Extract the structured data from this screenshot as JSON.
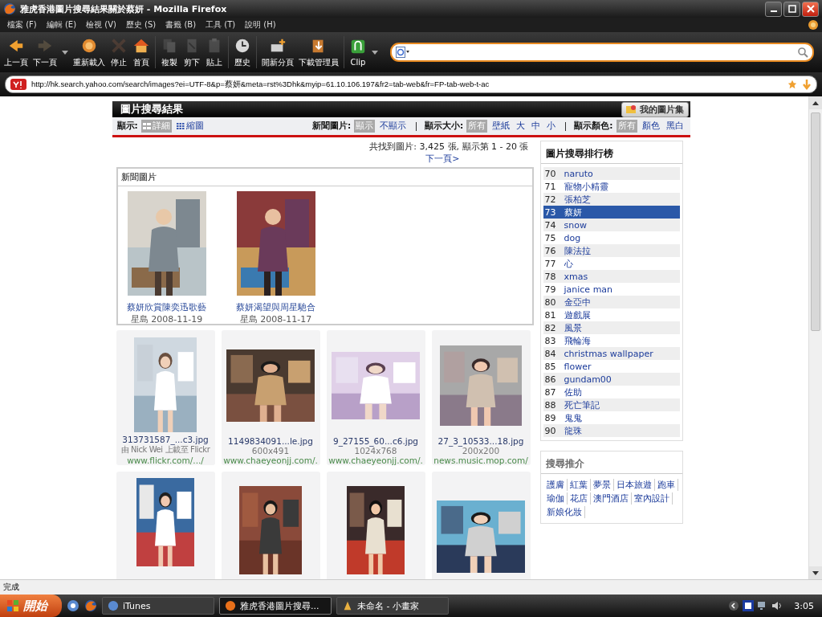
{
  "window": {
    "title": "雅虎香港圖片搜尋結果關於蔡妍 - Mozilla Firefox"
  },
  "menu": [
    "檔案 (F)",
    "編輯 (E)",
    "檢視 (V)",
    "歷史 (S)",
    "書籤 (B)",
    "工具 (T)",
    "說明 (H)"
  ],
  "toolbar": [
    {
      "kind": "back",
      "label": "上一頁",
      "disabled": false
    },
    {
      "kind": "forward",
      "label": "下一頁",
      "disabled": true
    },
    {
      "kind": "reload",
      "label": "重新載入",
      "disabled": false
    },
    {
      "kind": "stop",
      "label": "停止",
      "disabled": true
    },
    {
      "kind": "home",
      "label": "首頁",
      "disabled": false
    },
    {
      "kind": "copy",
      "label": "複製",
      "disabled": true
    },
    {
      "kind": "cut",
      "label": "剪下",
      "disabled": true
    },
    {
      "kind": "paste",
      "label": "貼上",
      "disabled": true
    },
    {
      "kind": "history",
      "label": "歷史",
      "disabled": false
    },
    {
      "kind": "newtab",
      "label": "開新分頁",
      "disabled": false
    },
    {
      "kind": "download",
      "label": "下載管理員",
      "disabled": false
    },
    {
      "kind": "clip",
      "label": "Clip",
      "disabled": false
    }
  ],
  "address": {
    "url": "http://hk.search.yahoo.com/search/images?ei=UTF-8&p=蔡妍&meta=rst%3Dhk&myip=61.10.106.197&fr2=tab-web&fr=FP-tab-web-t-ac"
  },
  "page": {
    "header": "圖片搜尋結果",
    "my_pictures": "我的圖片集",
    "filters": [
      {
        "label": "顯示:",
        "options": [
          {
            "text": "詳細",
            "selected": true
          },
          {
            "text": "縮圖",
            "selected": false
          }
        ]
      },
      {
        "label": "新聞圖片:",
        "options": [
          {
            "text": "顯示",
            "selected": true
          },
          {
            "text": "不顯示",
            "selected": false
          }
        ]
      },
      {
        "label": "顯示大小:",
        "options": [
          {
            "text": "所有",
            "selected": true
          },
          {
            "text": "壁紙",
            "selected": false
          },
          {
            "text": "大",
            "selected": false
          },
          {
            "text": "中",
            "selected": false
          },
          {
            "text": "小",
            "selected": false
          }
        ]
      },
      {
        "label": "顯示顏色:",
        "options": [
          {
            "text": "所有",
            "selected": true
          },
          {
            "text": "顏色",
            "selected": false
          },
          {
            "text": "黑白",
            "selected": false
          }
        ]
      }
    ],
    "summary": "共找到圖片: 3,425 張, 顯示第 1 - 20 張",
    "next_page": "下一頁>",
    "news": {
      "title": "新聞圖片",
      "items": [
        {
          "caption": "蔡妍欣賞陳奕迅歌藝",
          "source": "星島",
          "date": "2008-11-19"
        },
        {
          "caption": "蔡妍渴望與周星馳合",
          "source": "星島",
          "date": "2008-11-17"
        }
      ]
    },
    "results": [
      {
        "kind": "result",
        "file": "313731587_...c3.jpg",
        "info": "由 Nick Wei 上載至 Flickr",
        "site": "www.flickr.com/.../"
      },
      {
        "kind": "result",
        "file": "1149834091...le.jpg",
        "info": "600x491",
        "site": "www.chaeyeonjj.com/."
      },
      {
        "kind": "result",
        "file": "9_27155_60...c6.jpg",
        "info": "1024x768",
        "site": "www.chaeyeonjj.com/."
      },
      {
        "kind": "result",
        "file": "27_3_10533...18.jpg",
        "info": "200x200",
        "site": "news.music.mop.com/"
      },
      {
        "kind": "picture"
      },
      {
        "kind": "picture"
      },
      {
        "kind": "picture"
      },
      {
        "kind": "picture"
      }
    ],
    "ranking": {
      "title": "圖片搜尋排行榜",
      "items": [
        {
          "rank": "70",
          "term": "naruto",
          "selected": false
        },
        {
          "rank": "71",
          "term": "寵物小精靈",
          "selected": false
        },
        {
          "rank": "72",
          "term": "張柏芝",
          "selected": false
        },
        {
          "rank": "73",
          "term": "蔡妍",
          "selected": true
        },
        {
          "rank": "74",
          "term": "snow",
          "selected": false
        },
        {
          "rank": "75",
          "term": "dog",
          "selected": false
        },
        {
          "rank": "76",
          "term": "陳法拉",
          "selected": false
        },
        {
          "rank": "77",
          "term": "心",
          "selected": false
        },
        {
          "rank": "78",
          "term": "xmas",
          "selected": false
        },
        {
          "rank": "79",
          "term": "janice man",
          "selected": false
        },
        {
          "rank": "80",
          "term": "金亞中",
          "selected": false
        },
        {
          "rank": "81",
          "term": "遊戲展",
          "selected": false
        },
        {
          "rank": "82",
          "term": "風景",
          "selected": false
        },
        {
          "rank": "83",
          "term": "飛輪海",
          "selected": false
        },
        {
          "rank": "84",
          "term": "christmas wallpaper",
          "selected": false
        },
        {
          "rank": "85",
          "term": "flower",
          "selected": false
        },
        {
          "rank": "86",
          "term": "gundam00",
          "selected": false
        },
        {
          "rank": "87",
          "term": "佐助",
          "selected": false
        },
        {
          "rank": "88",
          "term": "死亡筆記",
          "selected": false
        },
        {
          "rank": "89",
          "term": "鬼鬼",
          "selected": false
        },
        {
          "rank": "90",
          "term": "龍珠",
          "selected": false
        }
      ]
    },
    "recommend": {
      "title": "搜尋推介",
      "links": [
        "護膚",
        "紅葉",
        "夢景",
        "日本旅遊",
        "跑車",
        "瑜伽",
        "花店",
        "澳門酒店",
        "室內設計",
        "新娘化妝"
      ]
    }
  },
  "status_bar": "完成",
  "taskbar": {
    "start": "開始",
    "tasks": [
      {
        "label": "iTunes",
        "selected": false
      },
      {
        "label": "雅虎香港圖片搜尋...",
        "selected": true
      },
      {
        "label": "未命名 - 小畫家",
        "selected": false
      }
    ],
    "clock": "3:05"
  }
}
